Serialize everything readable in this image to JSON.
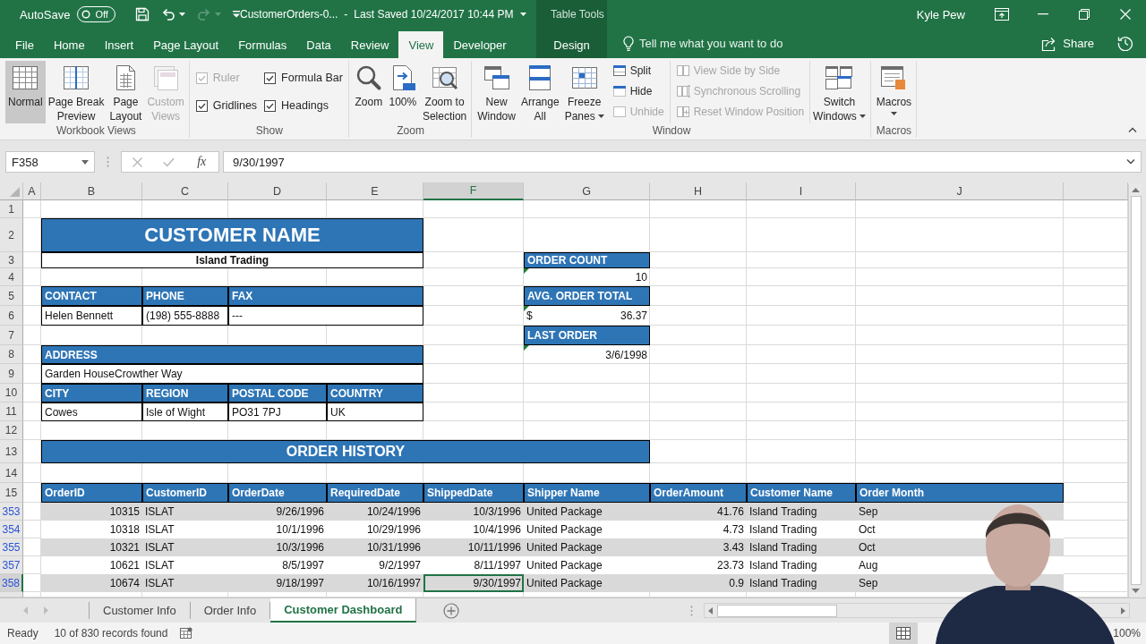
{
  "title_bar": {
    "autosave": {
      "label": "AutoSave",
      "toggle_label": "Off",
      "on": false
    },
    "document": "CustomerOrders-0...",
    "separator": "-",
    "last_saved": "Last Saved 10/24/2017 10:44 PM",
    "contextual_group": "Table Tools",
    "user": "Kyle Pew"
  },
  "ribbon_tabs": [
    {
      "label": "File",
      "selected": false,
      "contextual": false
    },
    {
      "label": "Home",
      "selected": false,
      "contextual": false
    },
    {
      "label": "Insert",
      "selected": false,
      "contextual": false
    },
    {
      "label": "Page Layout",
      "selected": false,
      "contextual": false
    },
    {
      "label": "Formulas",
      "selected": false,
      "contextual": false
    },
    {
      "label": "Data",
      "selected": false,
      "contextual": false
    },
    {
      "label": "Review",
      "selected": false,
      "contextual": false
    },
    {
      "label": "View",
      "selected": true,
      "contextual": false
    },
    {
      "label": "Developer",
      "selected": false,
      "contextual": false
    },
    {
      "label": "Design",
      "selected": false,
      "contextual": true
    }
  ],
  "tell_me": {
    "placeholder": "Tell me what you want to do"
  },
  "share": {
    "label": "Share"
  },
  "ribbon_groups": [
    {
      "label": "Workbook Views",
      "items": [
        {
          "kind": "large",
          "lines": [
            "Normal"
          ],
          "selected": true,
          "disabled": false,
          "dropdown": false
        },
        {
          "kind": "large",
          "lines": [
            "Page Break",
            "Preview"
          ],
          "selected": false,
          "disabled": false,
          "dropdown": false
        },
        {
          "kind": "large",
          "lines": [
            "Page",
            "Layout"
          ],
          "selected": false,
          "disabled": false,
          "dropdown": false
        },
        {
          "kind": "large",
          "lines": [
            "Custom",
            "Views"
          ],
          "selected": false,
          "disabled": true,
          "dropdown": false
        }
      ]
    },
    {
      "label": "Show",
      "items": [
        {
          "kind": "stack",
          "items": [
            {
              "kind": "check",
              "label": "Ruler",
              "checked": true,
              "disabled": true
            },
            {
              "kind": "check",
              "label": "Gridlines",
              "checked": true,
              "disabled": false
            }
          ]
        },
        {
          "kind": "stack",
          "items": [
            {
              "kind": "check",
              "label": "Formula Bar",
              "checked": true,
              "disabled": false
            },
            {
              "kind": "check",
              "label": "Headings",
              "checked": true,
              "disabled": false
            }
          ]
        }
      ]
    },
    {
      "label": "Zoom",
      "items": [
        {
          "kind": "large",
          "lines": [
            "Zoom"
          ],
          "disabled": false,
          "dropdown": false
        },
        {
          "kind": "large",
          "lines": [
            "100%"
          ],
          "disabled": false,
          "dropdown": false
        },
        {
          "kind": "large",
          "lines": [
            "Zoom to",
            "Selection"
          ],
          "disabled": false,
          "dropdown": false
        }
      ]
    },
    {
      "label": "Window",
      "items": [
        {
          "kind": "large",
          "lines": [
            "New",
            "Window"
          ],
          "disabled": false,
          "dropdown": false
        },
        {
          "kind": "large",
          "lines": [
            "Arrange",
            "All"
          ],
          "disabled": false,
          "dropdown": false
        },
        {
          "kind": "large",
          "lines": [
            "Freeze",
            "Panes"
          ],
          "disabled": false,
          "dropdown": true
        },
        {
          "kind": "stack",
          "items": [
            {
              "kind": "small",
              "label": "Split",
              "disabled": false
            },
            {
              "kind": "small",
              "label": "Hide",
              "disabled": false
            },
            {
              "kind": "small",
              "label": "Unhide",
              "disabled": true
            }
          ]
        },
        {
          "kind": "stack",
          "items": [
            {
              "kind": "small",
              "label": "View Side by Side",
              "disabled": true
            },
            {
              "kind": "small",
              "label": "Synchronous Scrolling",
              "disabled": true
            },
            {
              "kind": "small",
              "label": "Reset Window Position",
              "disabled": true
            }
          ]
        },
        {
          "kind": "large",
          "lines": [
            "Switch",
            "Windows"
          ],
          "disabled": false,
          "dropdown": true
        }
      ]
    },
    {
      "label": "Macros",
      "items": [
        {
          "kind": "large",
          "lines": [
            "Macros"
          ],
          "disabled": false,
          "dropdown": true
        }
      ]
    }
  ],
  "formula_bar": {
    "name_box": "F358",
    "function_button": "fx",
    "value": "9/30/1997"
  },
  "sheet": {
    "columns": [
      {
        "label": "A",
        "selected": false
      },
      {
        "label": "B",
        "selected": false
      },
      {
        "label": "C",
        "selected": false
      },
      {
        "label": "D",
        "selected": false
      },
      {
        "label": "E",
        "selected": false
      },
      {
        "label": "F",
        "selected": true
      },
      {
        "label": "G",
        "selected": false
      },
      {
        "label": "H",
        "selected": false
      },
      {
        "label": "I",
        "selected": false
      },
      {
        "label": "J",
        "selected": false
      }
    ],
    "rows": [
      {
        "label": "1",
        "filtered": false,
        "selected": false
      },
      {
        "label": "2",
        "filtered": false,
        "selected": false
      },
      {
        "label": "3",
        "filtered": false,
        "selected": false
      },
      {
        "label": "4",
        "filtered": false,
        "selected": false
      },
      {
        "label": "5",
        "filtered": false,
        "selected": false
      },
      {
        "label": "6",
        "filtered": false,
        "selected": false
      },
      {
        "label": "7",
        "filtered": false,
        "selected": false
      },
      {
        "label": "8",
        "filtered": false,
        "selected": false
      },
      {
        "label": "9",
        "filtered": false,
        "selected": false
      },
      {
        "label": "10",
        "filtered": false,
        "selected": false
      },
      {
        "label": "11",
        "filtered": false,
        "selected": false
      },
      {
        "label": "12",
        "filtered": false,
        "selected": false
      },
      {
        "label": "13",
        "filtered": false,
        "selected": false
      },
      {
        "label": "14",
        "filtered": false,
        "selected": false
      },
      {
        "label": "15",
        "filtered": false,
        "selected": false
      },
      {
        "label": "353",
        "filtered": true,
        "selected": false
      },
      {
        "label": "354",
        "filtered": true,
        "selected": false
      },
      {
        "label": "355",
        "filtered": true,
        "selected": false
      },
      {
        "label": "357",
        "filtered": true,
        "selected": false
      },
      {
        "label": "358",
        "filtered": true,
        "selected": true
      }
    ]
  },
  "customer_card": {
    "title": "CUSTOMER NAME",
    "name": "Island Trading",
    "contact": {
      "headers": [
        "CONTACT",
        "PHONE",
        "FAX"
      ],
      "values": [
        "Helen Bennett",
        "(198) 555-8888",
        "---"
      ]
    },
    "address": {
      "header": "ADDRESS",
      "value": "Garden HouseCrowther Way"
    },
    "location": {
      "headers": [
        "CITY",
        "REGION",
        "POSTAL CODE",
        "COUNTRY"
      ],
      "values": [
        "Cowes",
        "Isle of Wight",
        "PO31 7PJ",
        "UK"
      ]
    }
  },
  "summary": [
    {
      "header": "ORDER COUNT",
      "value": "10",
      "flagged": true
    },
    {
      "header": "AVG. ORDER TOTAL",
      "currency": "$",
      "value": "36.37",
      "flagged": true
    },
    {
      "header": "LAST ORDER",
      "value": "3/6/1998",
      "flagged": true
    }
  ],
  "order_history": {
    "title": "ORDER HISTORY",
    "columns": [
      "OrderID",
      "CustomerID",
      "OrderDate",
      "RequiredDate",
      "ShippedDate",
      "Shipper Name",
      "OrderAmount",
      "Customer Name",
      "Order Month"
    ],
    "rows": [
      {
        "cells": [
          "10315",
          "ISLAT",
          "9/26/1996",
          "10/24/1996",
          "10/3/1996",
          "United Package",
          "41.76",
          "Island Trading",
          "Sep"
        ]
      },
      {
        "cells": [
          "10318",
          "ISLAT",
          "10/1/1996",
          "10/29/1996",
          "10/4/1996",
          "United Package",
          "4.73",
          "Island Trading",
          "Oct"
        ]
      },
      {
        "cells": [
          "10321",
          "ISLAT",
          "10/3/1996",
          "10/31/1996",
          "10/11/1996",
          "United Package",
          "3.43",
          "Island Trading",
          "Oct"
        ]
      },
      {
        "cells": [
          "10621",
          "ISLAT",
          "8/5/1997",
          "9/2/1997",
          "8/11/1997",
          "United Package",
          "23.73",
          "Island Trading",
          "Aug"
        ]
      },
      {
        "cells": [
          "10674",
          "ISLAT",
          "9/18/1997",
          "10/16/1997",
          "9/30/1997",
          "United Package",
          "0.9",
          "Island Trading",
          "Sep"
        ]
      }
    ]
  },
  "sheet_tabs": [
    {
      "label": "Customer Info",
      "selected": false
    },
    {
      "label": "Order Info",
      "selected": false
    },
    {
      "label": "Customer Dashboard",
      "selected": true
    }
  ],
  "status_bar": {
    "mode": "Ready",
    "message": "10 of 830 records found",
    "zoom": "100%"
  }
}
